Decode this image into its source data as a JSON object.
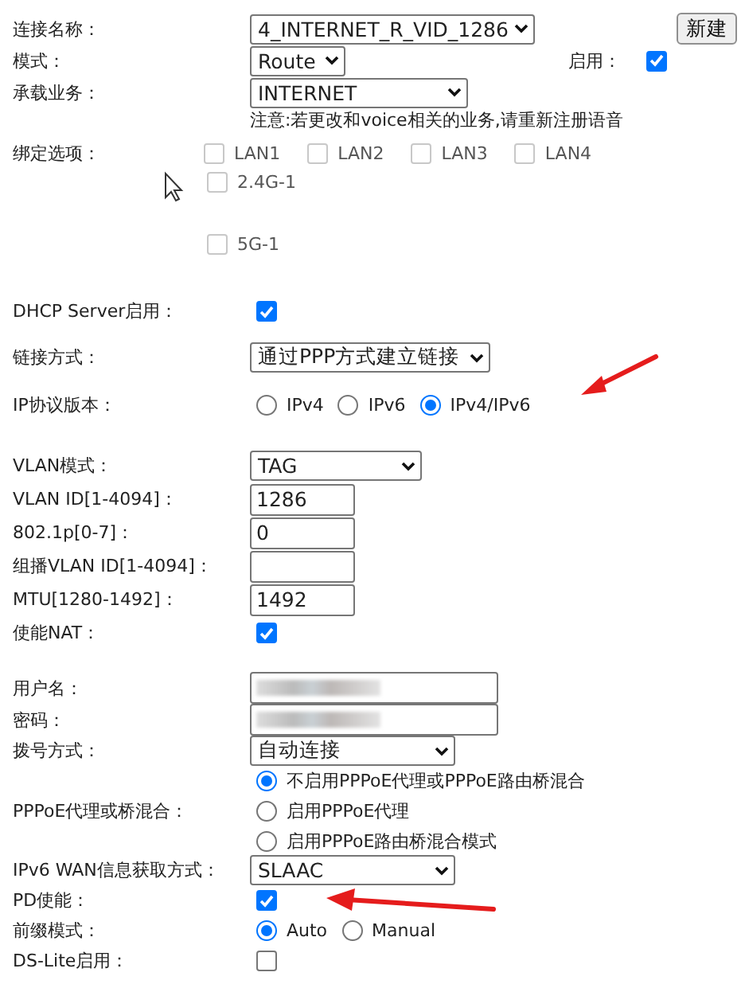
{
  "connection_name": {
    "label": "连接名称：",
    "value": "4_INTERNET_R_VID_1286",
    "button": "新建"
  },
  "mode": {
    "label": "模式：",
    "value": "Route",
    "enable_label": "启用：",
    "enabled": true
  },
  "service": {
    "label": "承载业务：",
    "value": "INTERNET",
    "note": "注意:若更改和voice相关的业务,请重新注册语音"
  },
  "binding": {
    "label": "绑定选项：",
    "lan_ports": [
      {
        "label": "LAN1",
        "checked": false,
        "disabled": true
      },
      {
        "label": "LAN2",
        "checked": false,
        "disabled": true
      },
      {
        "label": "LAN3",
        "checked": false,
        "disabled": true
      },
      {
        "label": "LAN4",
        "checked": false,
        "disabled": true
      }
    ],
    "wireless": [
      {
        "label": "2.4G-1",
        "checked": false,
        "disabled": true
      },
      {
        "label": "5G-1",
        "checked": false,
        "disabled": true
      }
    ]
  },
  "groups": [
    [
      {
        "kind": "checkbox",
        "label": "DHCP Server启用：",
        "checked": true
      }
    ],
    [
      {
        "kind": "select",
        "label": "链接方式：",
        "value": "通过PPP方式建立链接"
      }
    ],
    [
      {
        "kind": "radio-row",
        "label": "IP协议版本：",
        "options": [
          {
            "label": "IPv4",
            "selected": false
          },
          {
            "label": "IPv6",
            "selected": false
          },
          {
            "label": "IPv4/IPv6",
            "selected": true
          }
        ]
      }
    ],
    [
      {
        "kind": "select",
        "label": "VLAN模式：",
        "value": "TAG"
      },
      {
        "kind": "text",
        "label": "VLAN ID[1-4094]：",
        "value": "1286"
      },
      {
        "kind": "text",
        "label": "802.1p[0-7]：",
        "value": "0"
      },
      {
        "kind": "text",
        "label": "组播VLAN ID[1-4094]："
      },
      {
        "kind": "text",
        "label": "MTU[1280-1492]：",
        "value": "1492"
      },
      {
        "kind": "checkbox",
        "label": "使能NAT：",
        "checked": true
      }
    ],
    [
      {
        "kind": "redacted",
        "label": "用户名："
      },
      {
        "kind": "redacted",
        "label": "密码："
      },
      {
        "kind": "select",
        "label": "拨号方式：",
        "value": "自动连接"
      },
      {
        "kind": "radio-column",
        "label": "PPPoE代理或桥混合：",
        "options": [
          {
            "label": "不启用PPPoE代理或PPPoE路由桥混合",
            "selected": true
          },
          {
            "label": "启用PPPoE代理",
            "selected": false
          },
          {
            "label": "启用PPPoE路由桥混合模式",
            "selected": false
          }
        ]
      },
      {
        "kind": "select",
        "label": "IPv6 WAN信息获取方式：",
        "value": "SLAAC"
      },
      {
        "kind": "checkbox",
        "label": "PD使能：",
        "checked": true
      },
      {
        "kind": "radio-row",
        "label": "前缀模式：",
        "options": [
          {
            "label": "Auto",
            "selected": true
          },
          {
            "label": "Manual",
            "selected": false
          }
        ]
      },
      {
        "kind": "checkbox",
        "label": "DS-Lite启用：",
        "checked": false
      }
    ]
  ]
}
